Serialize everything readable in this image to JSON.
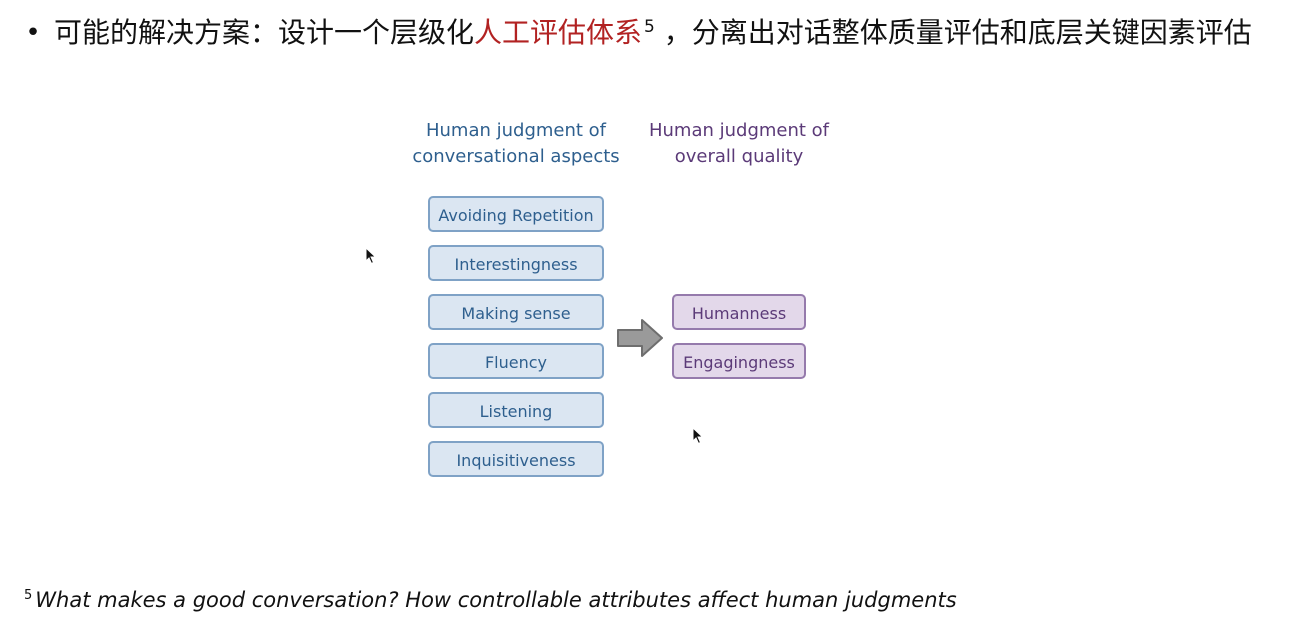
{
  "bullet": {
    "symbol": "•",
    "text_before": "可能的解决方案：设计一个层级化",
    "highlight": "人工评估体系",
    "superscript": "5",
    "text_after": " ，分离出对话整体质量评估和底层关键因素评估",
    "highlight_color": "#b22222"
  },
  "diagram": {
    "left_title": "Human judgment of conversational aspects",
    "right_title": "Human judgment of overall quality",
    "aspects": [
      "Avoiding Repetition",
      "Interestingness",
      "Making sense",
      "Fluency",
      "Listening",
      "Inquisitiveness"
    ],
    "qualities": [
      "Humanness",
      "Engagingness"
    ],
    "arrow_icon": "right-arrow-icon",
    "colors": {
      "aspect_text": "#2e5f8e",
      "aspect_fill": "#dbe6f2",
      "quality_text": "#5b3a78",
      "quality_fill": "#e3d8ea",
      "arrow_fill": "#9a9a9a"
    }
  },
  "footnote": {
    "number": "5",
    "text": "What makes a good conversation? How controllable attributes affect human judgments"
  },
  "cursor_icon": "mouse-pointer-icon"
}
